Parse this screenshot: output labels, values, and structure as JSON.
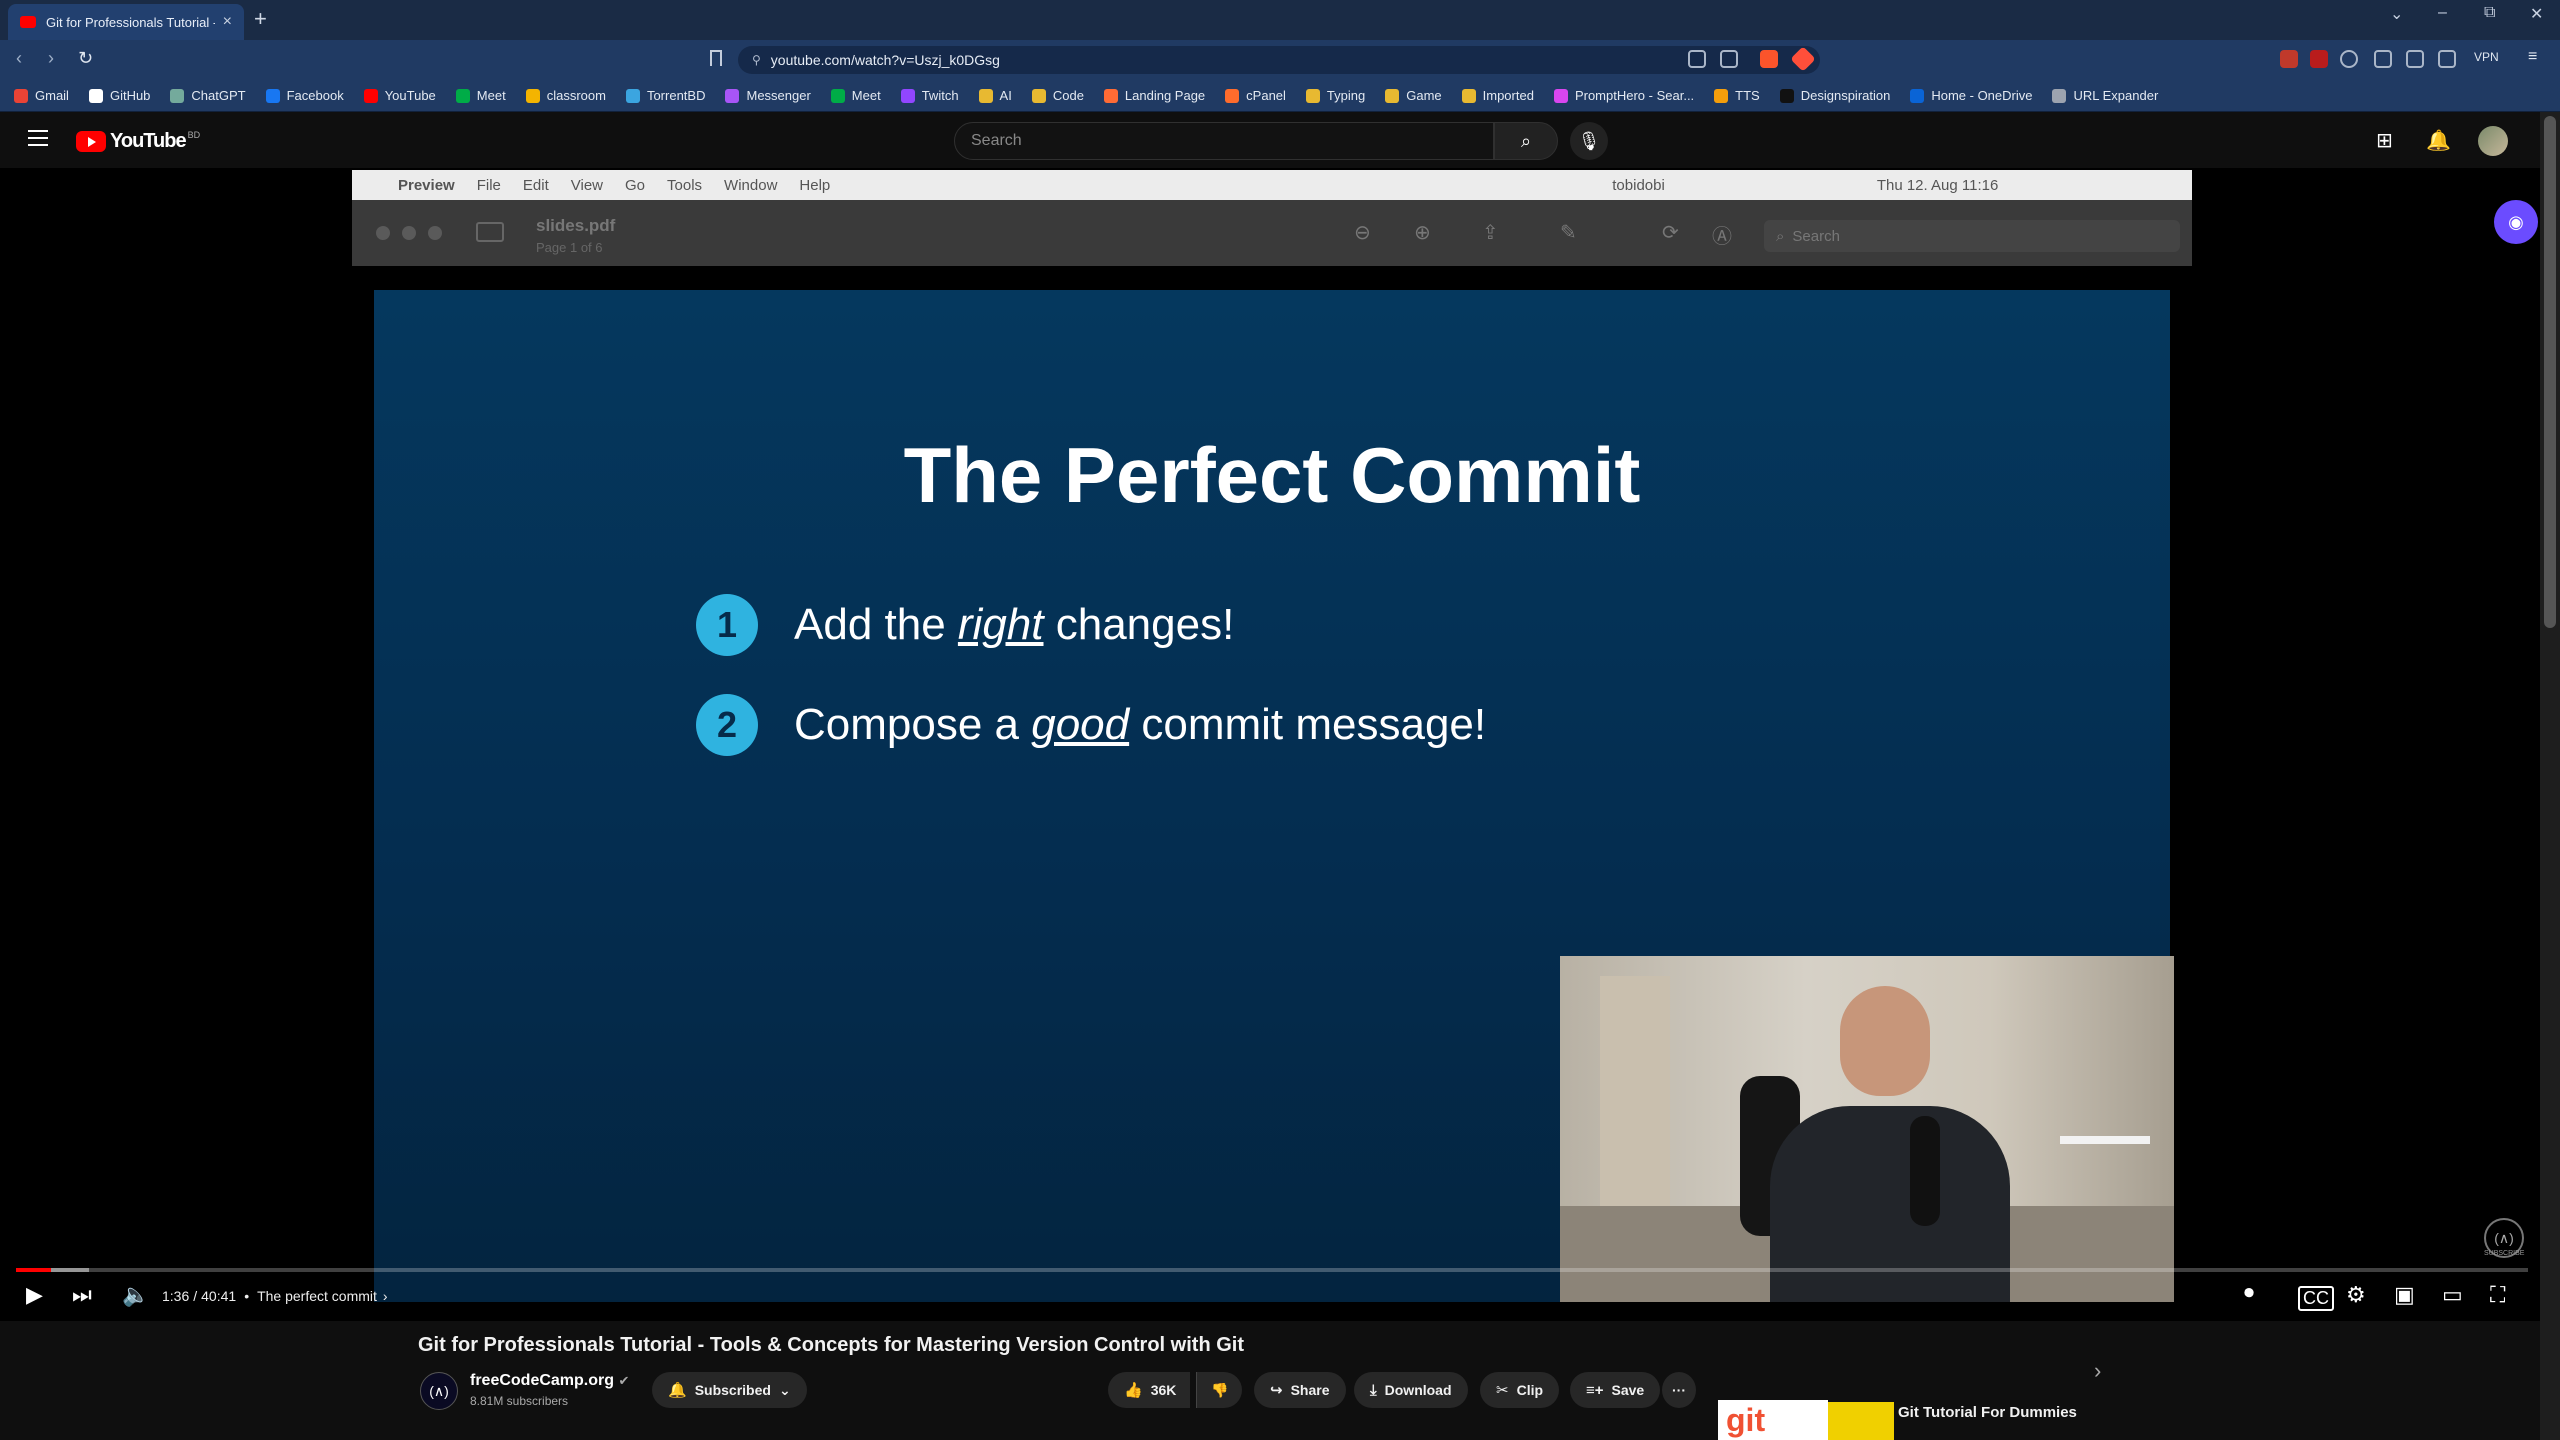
{
  "browser": {
    "tab_title": "Git for Professionals Tutorial - To",
    "tab_close": "×",
    "new_tab": "+",
    "url": "youtube.com/watch?v=Uszj_k0DGsg",
    "window_controls": [
      "⌄",
      "–",
      "⧉",
      "✕"
    ],
    "nav": [
      "‹",
      "›",
      "↻"
    ],
    "bookmarks": [
      {
        "label": "Gmail",
        "color": "#ea4335"
      },
      {
        "label": "GitHub",
        "color": "#ffffff"
      },
      {
        "label": "ChatGPT",
        "color": "#74aa9c"
      },
      {
        "label": "Facebook",
        "color": "#1877f2"
      },
      {
        "label": "YouTube",
        "color": "#ff0000"
      },
      {
        "label": "Meet",
        "color": "#00ac47"
      },
      {
        "label": "classroom",
        "color": "#f4b400"
      },
      {
        "label": "TorrentBD",
        "color": "#3ba5e0"
      },
      {
        "label": "Messenger",
        "color": "#a855f7"
      },
      {
        "label": "Meet",
        "color": "#00ac47"
      },
      {
        "label": "Twitch",
        "color": "#9146ff"
      },
      {
        "label": "AI",
        "color": "#e8b931"
      },
      {
        "label": "Code",
        "color": "#e8b931"
      },
      {
        "label": "Landing Page",
        "color": "#ff6b35"
      },
      {
        "label": "cPanel",
        "color": "#ff6c2c"
      },
      {
        "label": "Typing",
        "color": "#e8b931"
      },
      {
        "label": "Game",
        "color": "#e8b931"
      },
      {
        "label": "Imported",
        "color": "#e8b931"
      },
      {
        "label": "PromptHero - Sear...",
        "color": "#d946ef"
      },
      {
        "label": "TTS",
        "color": "#f59e0b"
      },
      {
        "label": "Designspiration",
        "color": "#111111"
      },
      {
        "label": "Home - OneDrive",
        "color": "#0a64d6"
      },
      {
        "label": "URL Expander",
        "color": "#9ca3af"
      }
    ],
    "vpn_label": "VPN"
  },
  "youtube": {
    "logo_text": "YouTube",
    "country_code": "BD",
    "search_placeholder": "Search",
    "header_icons": [
      "create-icon",
      "notifications-icon"
    ]
  },
  "video": {
    "mac_menu": [
      "Preview",
      "File",
      "Edit",
      "View",
      "Go",
      "Tools",
      "Window",
      "Help"
    ],
    "mac_user": "tobidobi",
    "mac_clock": "Thu 12. Aug  11:16",
    "preview_file": "slides.pdf",
    "preview_page": "Page 1 of 6",
    "preview_search": "Search",
    "slide_title": "The Perfect Commit",
    "bullets": [
      {
        "num": "1",
        "pre": "Add the ",
        "em": "right",
        "post": " changes!"
      },
      {
        "num": "2",
        "pre": "Compose a ",
        "em": "good",
        "post": " commit message!"
      }
    ],
    "time_current": "1:36",
    "time_total": "40:41",
    "chapter": "The perfect commit",
    "progress_played": 0.014,
    "progress_buffered": 0.029,
    "watermark_sub": "SUBSCRIBE"
  },
  "details": {
    "title": "Git for Professionals Tutorial - Tools & Concepts for Mastering Version Control with Git",
    "channel": "freeCodeCamp.org",
    "subscribers": "8.81M subscribers",
    "subscribed_label": "Subscribed",
    "likes": "36K",
    "share": "Share",
    "download": "Download",
    "clip": "Clip",
    "save": "Save",
    "more": "···",
    "reco_title": "Git Tutorial For Dummies",
    "reco_thumb_text": "git"
  }
}
